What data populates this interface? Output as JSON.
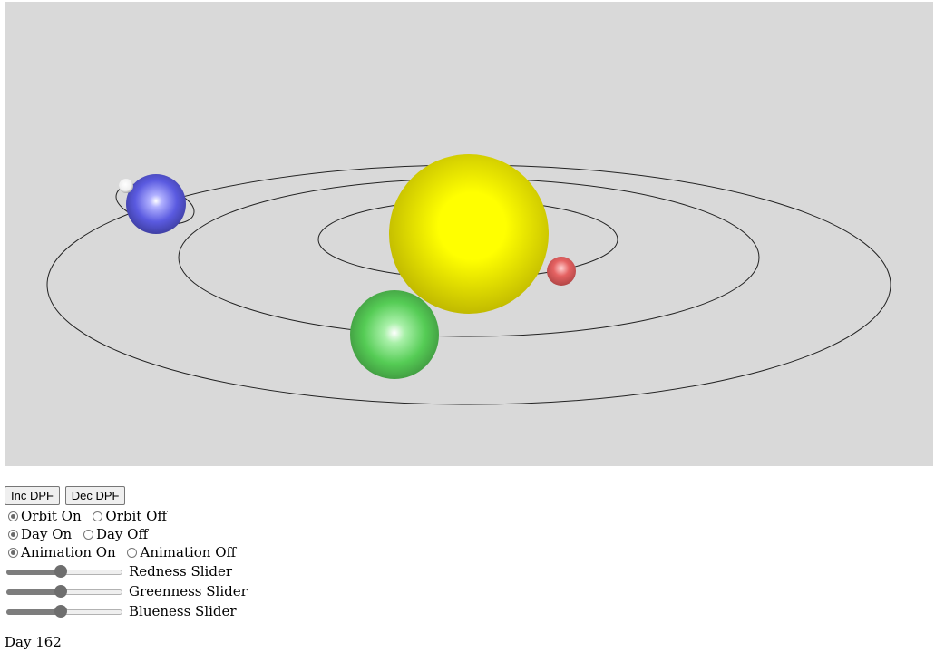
{
  "scene": {
    "background": "#d9d9d9",
    "sun_color": "#ffff00",
    "planets": [
      {
        "name": "red-planet",
        "color": "#e06060"
      },
      {
        "name": "green-planet",
        "color": "#55cc55"
      },
      {
        "name": "blue-planet",
        "color": "#5555dd"
      },
      {
        "name": "moon",
        "color": "#ffffff"
      }
    ]
  },
  "buttons": {
    "inc": "Inc DPF",
    "dec": "Dec DPF"
  },
  "orbit": {
    "on_label": "Orbit On",
    "off_label": "Orbit Off",
    "selected": "on"
  },
  "day_toggle": {
    "on_label": "Day On",
    "off_label": "Day Off",
    "selected": "on"
  },
  "animation": {
    "on_label": "Animation On",
    "off_label": "Animation Off",
    "selected": "on"
  },
  "sliders": {
    "red": {
      "label": "Redness Slider",
      "value": 0.47
    },
    "green": {
      "label": "Greenness Slider",
      "value": 0.47
    },
    "blue": {
      "label": "Blueness Slider",
      "value": 0.47
    }
  },
  "status": {
    "day_text": "Day 162"
  }
}
